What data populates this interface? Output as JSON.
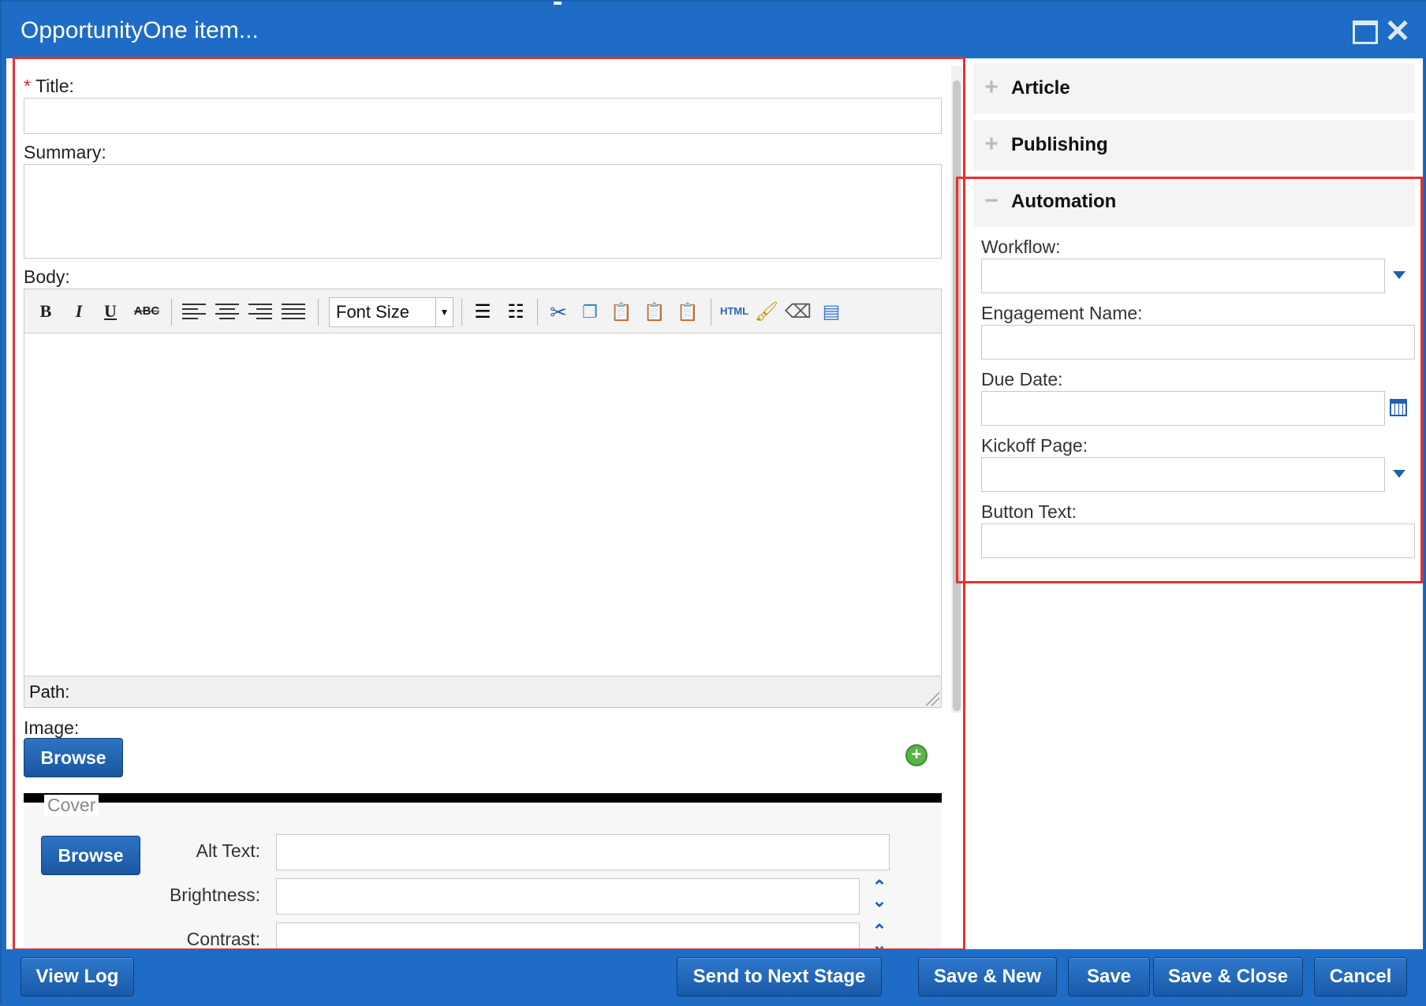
{
  "window": {
    "title": "OpportunityOne item..."
  },
  "form": {
    "title_label": "Title:",
    "required_marker": "*",
    "summary_label": "Summary:",
    "body_label": "Body:",
    "font_size_select": "Font Size",
    "toolbar": {
      "bold": "B",
      "italic": "I",
      "underline": "U",
      "strikethrough": "ABC",
      "html": "HTML"
    },
    "path_label": "Path:",
    "image_label": "Image:",
    "browse_label": "Browse",
    "cover_legend": "Cover",
    "cover_browse_label": "Browse",
    "alt_text_label": "Alt Text:",
    "brightness_label": "Brightness:",
    "contrast_label": "Contrast:"
  },
  "sidebar": {
    "sections": [
      {
        "title": "Article",
        "expanded": false
      },
      {
        "title": "Publishing",
        "expanded": false
      },
      {
        "title": "Automation",
        "expanded": true
      }
    ],
    "automation": {
      "workflow_label": "Workflow:",
      "engagement_label": "Engagement Name:",
      "due_date_label": "Due Date:",
      "kickoff_label": "Kickoff Page:",
      "button_text_label": "Button Text:"
    }
  },
  "footer": {
    "view_log": "View Log",
    "send_next": "Send to Next Stage",
    "save_new": "Save & New",
    "save": "Save",
    "save_close": "Save & Close",
    "cancel": "Cancel"
  },
  "colors": {
    "titlebar": "#1e6cc6",
    "highlight": "#e8302f",
    "accent": "#1f5fae"
  }
}
